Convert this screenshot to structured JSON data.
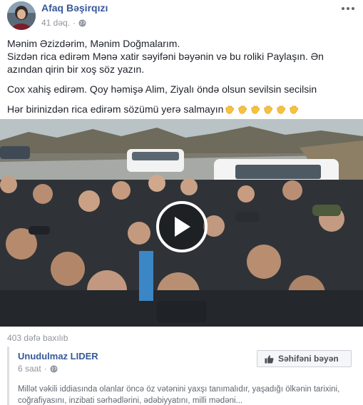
{
  "post": {
    "author": "Afaq Bəşirqızı",
    "time": "41 dəq.",
    "privacy_icon": "globe-icon",
    "text_lines": [
      "Mənim Əzizdərim, Mənim Doğmalarım.",
      "Sizdən rica edirəm Mənə xatir səyifəni bəyənin və bu roliki Paylaşın. Ən azından qirin bir xoş söz yazın.",
      "Cox xahiş edirəm. Qoy həmişə Alim, Ziyalı öndə olsun sevilsin secilsin",
      "Hər birinizdən rica edirəm sözümü yerə salmayın"
    ],
    "emoji": [
      "clapping-hands",
      "clapping-hands",
      "clapping-hands",
      "clapping-hands",
      "clapping-hands",
      "clapping-hands"
    ]
  },
  "video": {
    "play_icon": "play-icon",
    "views": "403 dəfə baxılıb"
  },
  "shared": {
    "author": "Unudulmaz LIDER",
    "time": "6 saat",
    "privacy_icon": "globe-icon",
    "like_page_label": "Səhifəni bəyən",
    "text": "Millət vəkili iddiasında olanlar öncə öz vətənini yaxşı tanımalıdır, yaşadığı ölkənin tarixini, coğrafiyasını, inzibati sərhədlərini, ədəbiyyatını, milli mədəni..."
  },
  "colors": {
    "link": "#365899",
    "meta": "#90949c",
    "text": "#1d2129"
  }
}
